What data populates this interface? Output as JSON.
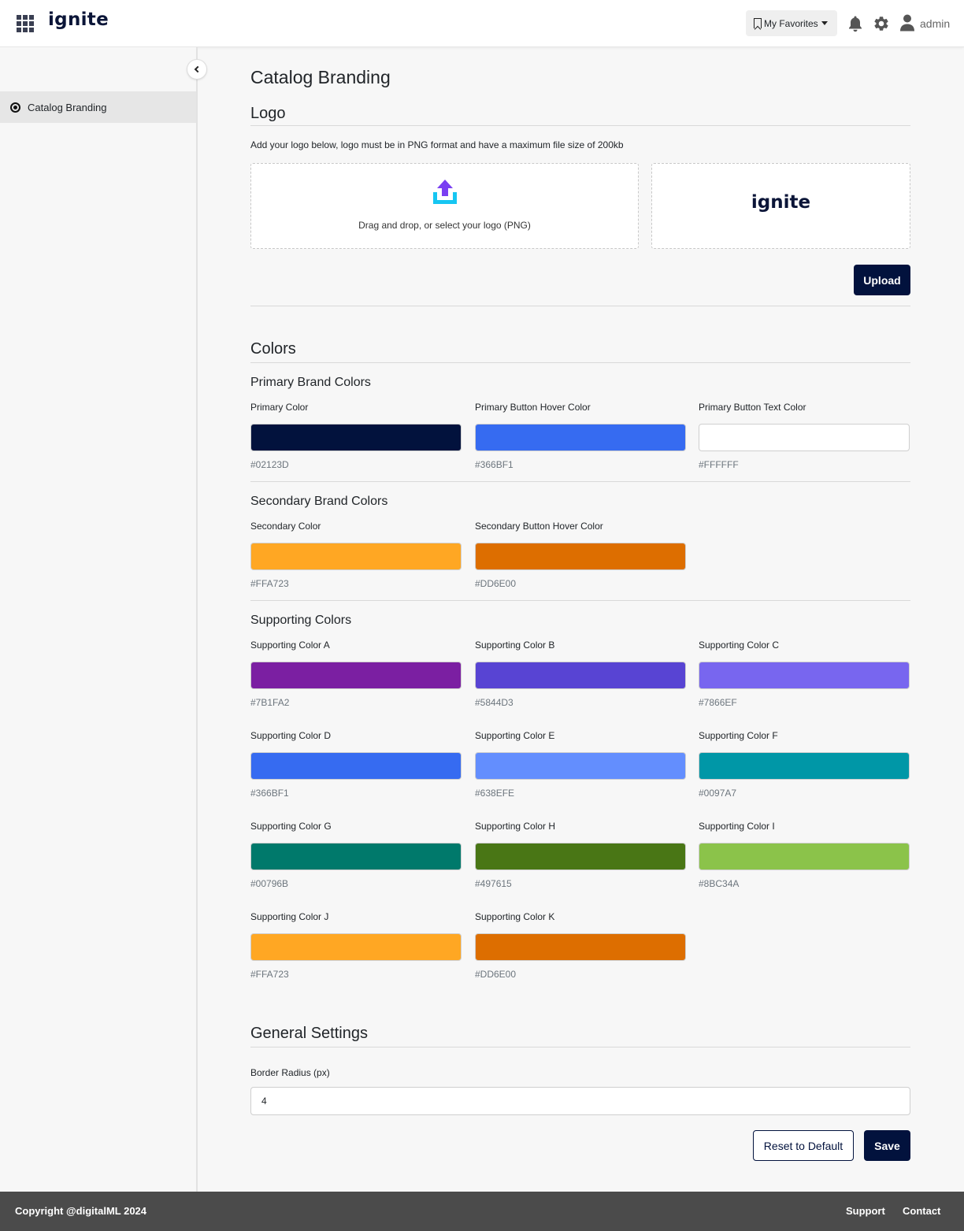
{
  "header": {
    "brand": "ignite",
    "favorites_label": "My Favorites",
    "user_name": "admin"
  },
  "sidebar": {
    "items": [
      {
        "label": "Catalog Branding"
      }
    ]
  },
  "page": {
    "title": "Catalog Branding"
  },
  "logo_section": {
    "title": "Logo",
    "hint": "Add your logo below, logo must be in PNG format and have a maximum file size of 200kb",
    "dropzone_text": "Drag and drop, or select your logo (PNG)",
    "preview_logo": "ignite",
    "upload_label": "Upload"
  },
  "colors_section": {
    "title": "Colors",
    "primary": {
      "title": "Primary Brand Colors",
      "colors": [
        {
          "label": "Primary Color",
          "hex": "#02123D"
        },
        {
          "label": "Primary Button Hover Color",
          "hex": "#366BF1"
        },
        {
          "label": "Primary Button Text Color",
          "hex": "#FFFFFF"
        }
      ]
    },
    "secondary": {
      "title": "Secondary Brand Colors",
      "colors": [
        {
          "label": "Secondary Color",
          "hex": "#FFA723"
        },
        {
          "label": "Secondary Button Hover Color",
          "hex": "#DD6E00"
        }
      ]
    },
    "supporting": {
      "title": "Supporting Colors",
      "colors": [
        {
          "label": "Supporting Color A",
          "hex": "#7B1FA2"
        },
        {
          "label": "Supporting Color B",
          "hex": "#5844D3"
        },
        {
          "label": "Supporting Color C",
          "hex": "#7866EF"
        },
        {
          "label": "Supporting Color D",
          "hex": "#366BF1"
        },
        {
          "label": "Supporting Color E",
          "hex": "#638EFE"
        },
        {
          "label": "Supporting Color F",
          "hex": "#0097A7"
        },
        {
          "label": "Supporting Color G",
          "hex": "#00796B"
        },
        {
          "label": "Supporting Color H",
          "hex": "#497615"
        },
        {
          "label": "Supporting Color I",
          "hex": "#8BC34A"
        },
        {
          "label": "Supporting Color J",
          "hex": "#FFA723"
        },
        {
          "label": "Supporting Color K",
          "hex": "#DD6E00"
        }
      ]
    }
  },
  "general_section": {
    "title": "General Settings",
    "border_radius_label": "Border Radius (px)",
    "border_radius_value": "4",
    "reset_label": "Reset to Default",
    "save_label": "Save"
  },
  "footer": {
    "copyright": "Copyright @digitalML 2024",
    "support": "Support",
    "contact": "Contact"
  },
  "icons": {
    "apps": "apps-grid-icon",
    "bookmark": "bookmark-icon",
    "bell": "bell-icon",
    "gear": "gear-icon",
    "user": "user-icon",
    "collapse": "chevron-left-icon",
    "upload": "upload-icon"
  }
}
